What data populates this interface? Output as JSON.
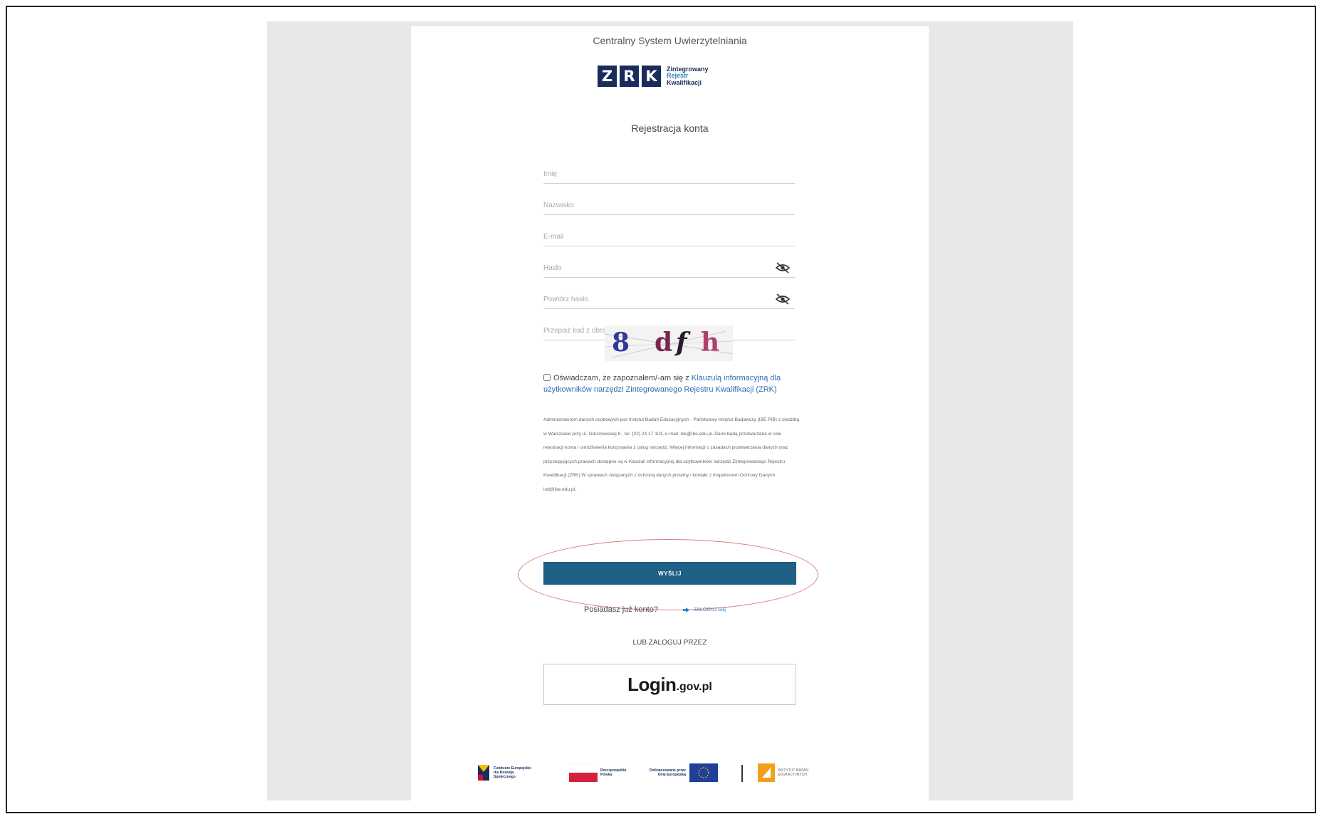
{
  "header": {
    "app_title": "Centralny System Uwierzytelniania"
  },
  "logo": {
    "letters": [
      "Z",
      "R",
      "K"
    ],
    "line1": "Zintegrowany",
    "line2": "Rejestr",
    "line3": "Kwalifikacji"
  },
  "form": {
    "title": "Rejestracja konta",
    "fields": {
      "first_name": {
        "placeholder": "Imię"
      },
      "last_name": {
        "placeholder": "Nazwisko"
      },
      "email": {
        "placeholder": "E-mail"
      },
      "password": {
        "placeholder": "Hasło"
      },
      "password_repeat": {
        "placeholder": "Powtórz hasło"
      },
      "captcha_input": {
        "placeholder": "Przepisz kod z obrazka"
      }
    },
    "captcha_text": "8 dfh",
    "consent": {
      "prefix": "Oświadczam, że zapoznałem/-am się z",
      "link": "Klauzulą informacyjną dla użytkowników narzędzi Zintegrowanego Rejestru Kwalifikacji (ZRK)"
    },
    "rodo_text": "Administratorem danych osobowych jest Instytut Badań Edukacyjnych - Państwowy Instytut Badawczy (IBE PIB) z siedzibą w Warszawie przy ul. Górczewskiej 8 , tel. (22) 24 17 101, e-mail: ibe@ibe.edu.pl. Dane będą przetwarzane w celu rejestracji konta i umożliwienia korzystania z usług narzędzi. Więcej informacji o zasadach przetwarzania danych oraz przysługujących prawach dostępne są w Klauzuli informacyjnej dla użytkowników narzędzi Zintegrowanego Rejestru Kwalifikacji (ZRK) W sprawach związanych z ochroną danych prosimy i kontakt z Inspektorem Ochrony Danych iod@ibe.edu.pl.",
    "submit_label": "WYŚLIJ"
  },
  "account": {
    "question": "Posiadasz już konto?",
    "login_link": "ZALOGUJ SIĘ"
  },
  "alt_login": {
    "heading": "LUB ZALOGUJ PRZEZ",
    "brand_main": "Login",
    "brand_suffix": ".gov.pl"
  },
  "footer": {
    "logos": [
      {
        "label": "Fundusze Europejskie dla Rozwoju Społecznego"
      },
      {
        "label": "Rzeczpospolita Polska"
      },
      {
        "label": "Dofinansowane przez Unię Europejską"
      },
      {
        "label": "INSTYTUT BADAŃ EDUKACYJNYCH"
      }
    ]
  },
  "colors": {
    "accent": "#1e5f85",
    "brand_navy": "#1a2c5b",
    "link": "#2a7fc0",
    "annotation": "#e07a7a"
  }
}
